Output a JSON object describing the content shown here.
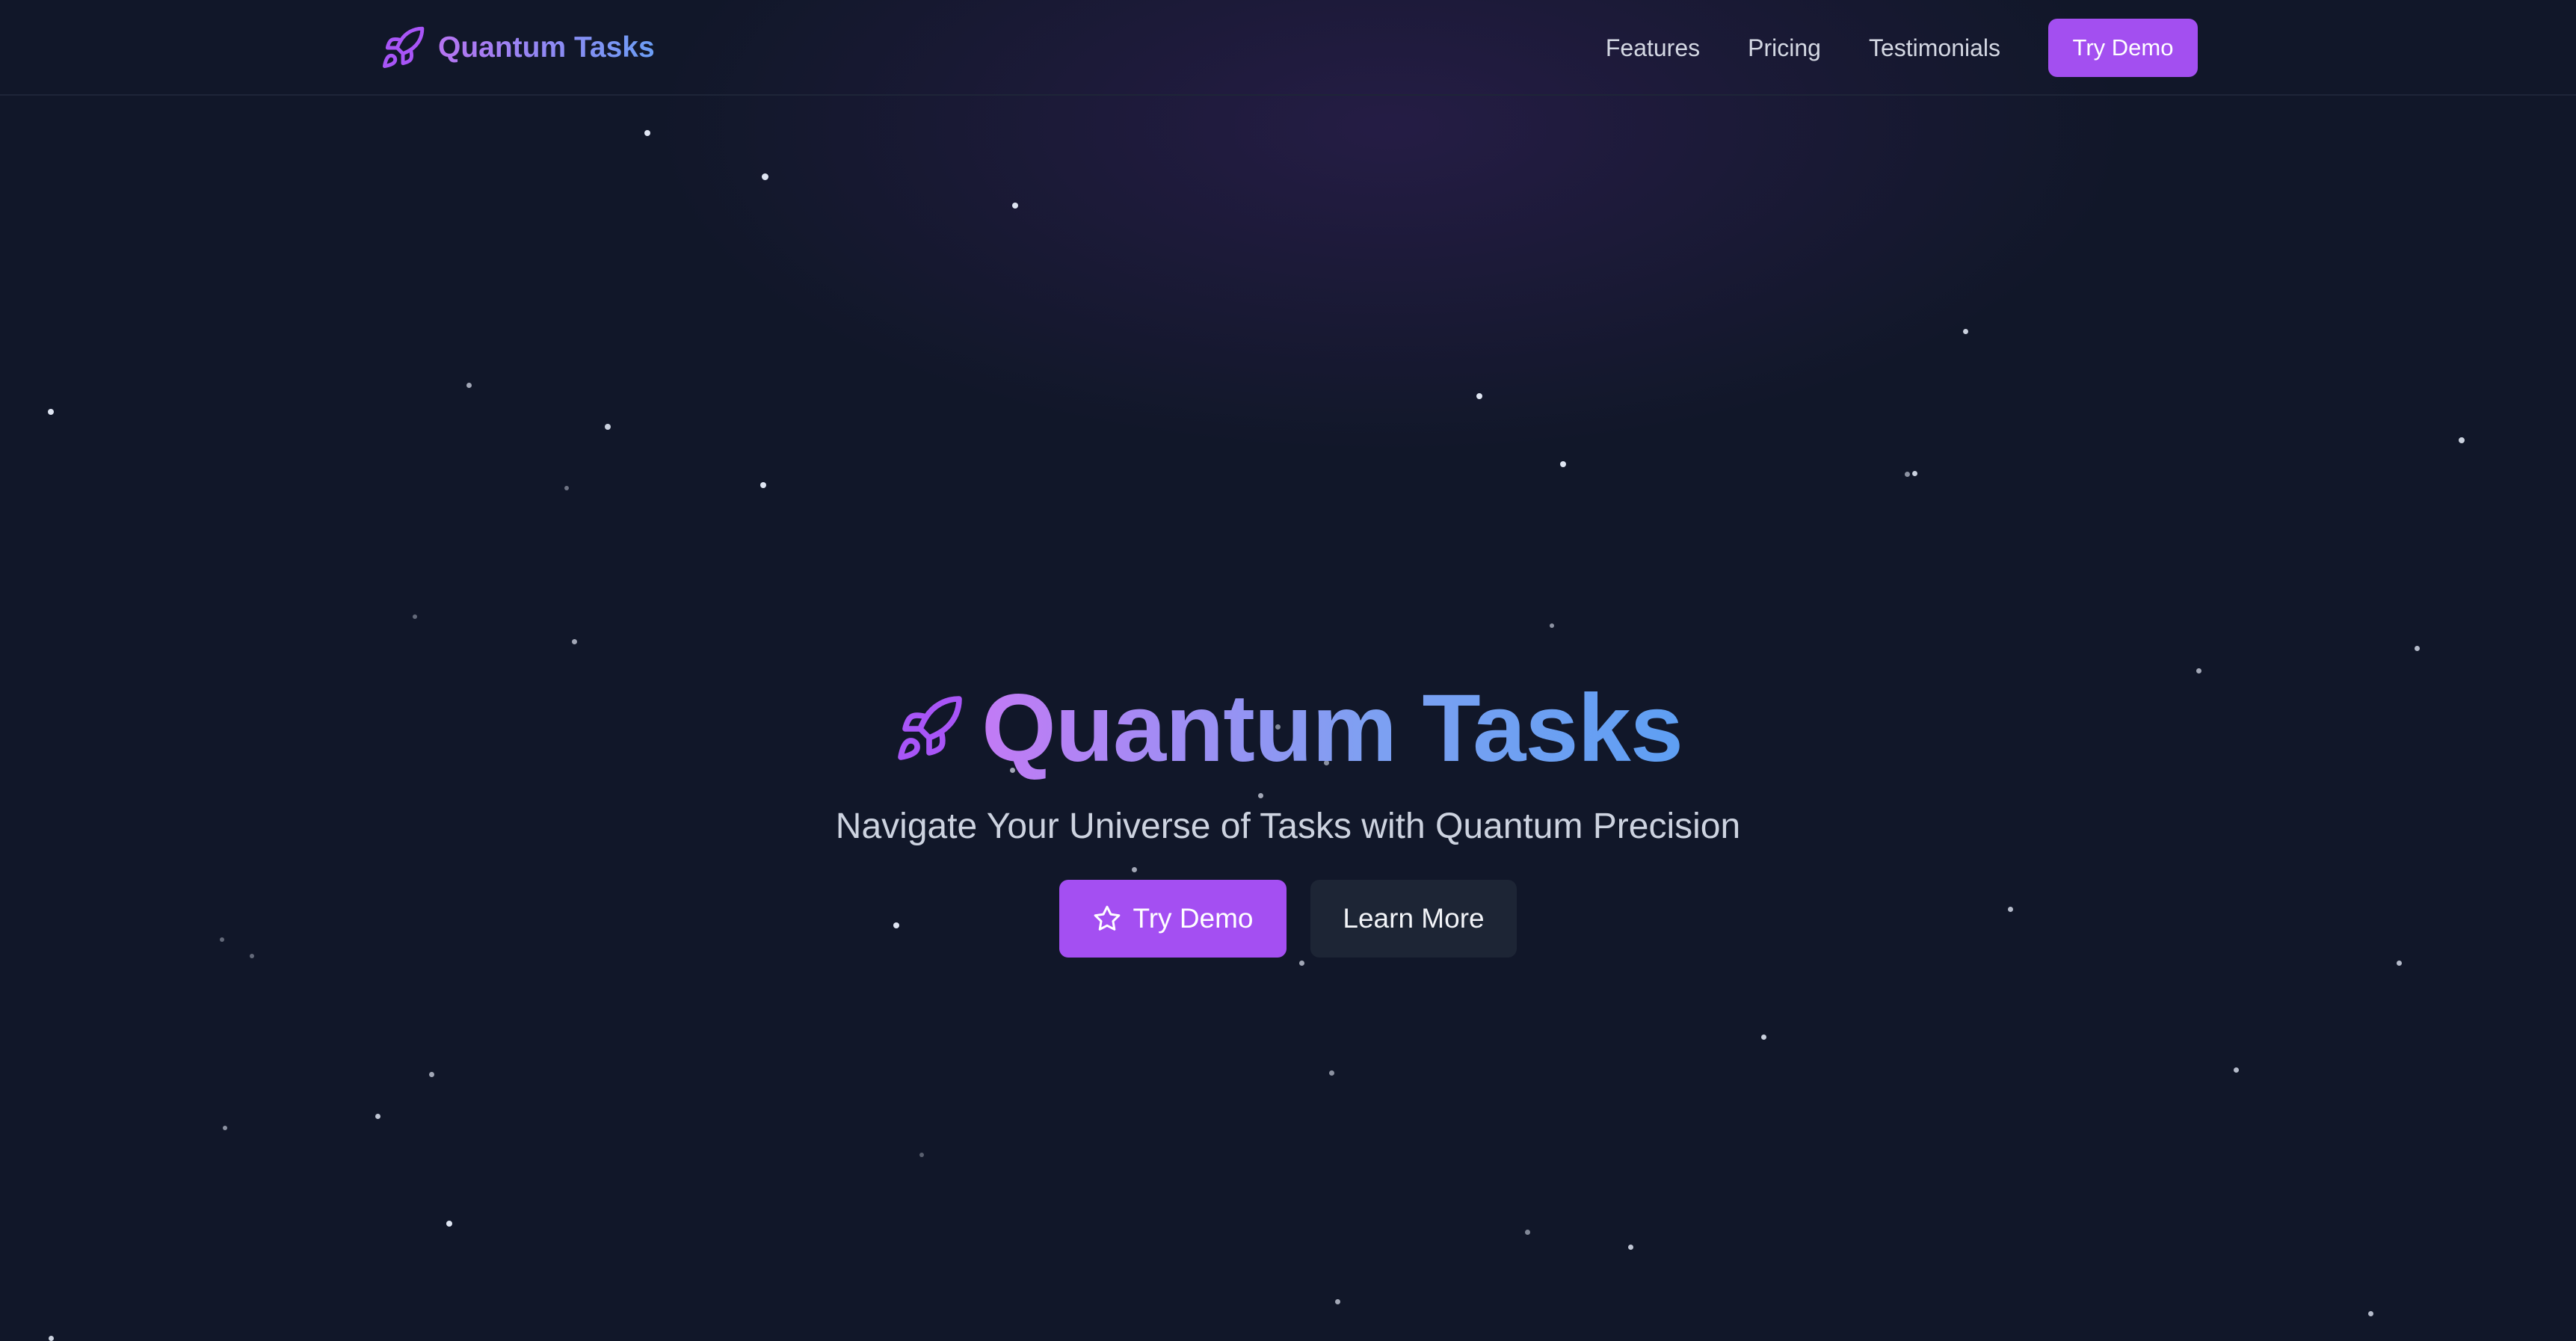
{
  "header": {
    "brand": "Quantum Tasks",
    "brand_icon": "rocket-icon",
    "nav": [
      {
        "label": "Features"
      },
      {
        "label": "Pricing"
      },
      {
        "label": "Testimonials"
      }
    ],
    "cta_label": "Try Demo"
  },
  "hero": {
    "icon": "rocket-icon",
    "title": "Quantum Tasks",
    "subtitle": "Navigate Your Universe of Tasks with Quantum Precision",
    "primary_button": {
      "label": "Try Demo",
      "icon": "star-icon"
    },
    "secondary_button": {
      "label": "Learn More"
    }
  },
  "colors": {
    "background": "#111729",
    "accent": "#a34ff0",
    "gradient_start": "#c27af5",
    "gradient_end": "#5e9ff3",
    "secondary_button": "#1d2535"
  }
}
